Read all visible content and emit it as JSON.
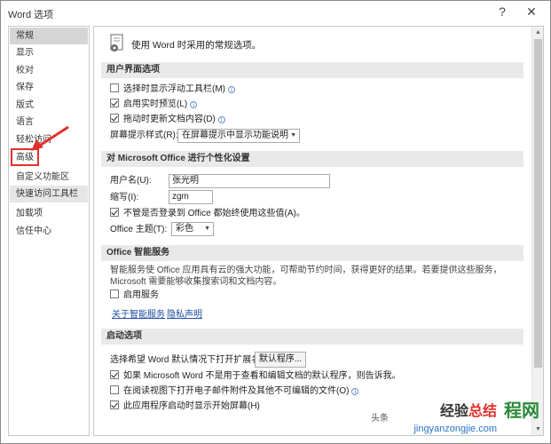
{
  "window": {
    "title": "Word 选项",
    "help": "?",
    "close": "✕"
  },
  "sidebar": {
    "items": [
      {
        "label": "常规"
      },
      {
        "label": "显示"
      },
      {
        "label": "校对"
      },
      {
        "label": "保存"
      },
      {
        "label": "版式"
      },
      {
        "label": "语言"
      },
      {
        "label": "轻松访问"
      },
      {
        "label": "高级"
      },
      {
        "label": "自定义功能区"
      },
      {
        "label": "快速访问工具栏"
      },
      {
        "label": "加载项"
      },
      {
        "label": "信任中心"
      }
    ],
    "selected": "常规"
  },
  "content": {
    "intro": "使用 Word 时采用的常规选项。",
    "ui_section": {
      "title": "用户界面选项",
      "opt1": {
        "label": "选择时显示浮动工具栏(M)",
        "checked": false
      },
      "opt2": {
        "label": "启用实时预览(L)",
        "checked": true
      },
      "opt3": {
        "label": "拖动时更新文档内容(D)",
        "checked": true
      },
      "tooltip_label": "屏幕提示样式(R):",
      "tooltip_value": "在屏幕提示中显示功能说明"
    },
    "personal_section": {
      "title": "对 Microsoft Office 进行个性化设置",
      "username_label": "用户名(U):",
      "username_value": "张光明",
      "initials_label": "缩写(I):",
      "initials_value": "zgm",
      "always_use": {
        "label": "不管是否登录到 Office 都始终使用这些值(A)。",
        "checked": true
      },
      "theme_label": "Office 主题(T):",
      "theme_value": "彩色"
    },
    "intelligent_section": {
      "title": "Office 智能服务",
      "description": "智能服务使 Office 应用具有云的强大功能，可帮助节约时间，获得更好的结果。若要提供这些服务，Microsoft 需要能够收集搜索词和文档内容。",
      "enable": {
        "label": "启用服务",
        "checked": false
      },
      "link_about": "关于智能服务",
      "link_privacy": "隐私声明"
    },
    "startup_section": {
      "title": "启动选项",
      "ext_label": "选择希望 Word 默认情况下打开扩展名:",
      "default_programs_button": "默认程序...",
      "opt1": {
        "label": "如果 Microsoft Word 不是用于查看和编辑文档的默认程序，则告诉我。",
        "checked": true
      },
      "opt2": {
        "label": "在阅读视图下打开电子邮件附件及其他不可编辑的文件(O)",
        "checked": false
      },
      "opt3": {
        "label": "此应用程序启动时显示开始屏幕(H)",
        "checked": true
      }
    }
  },
  "watermark": {
    "source_prefix": "头条",
    "brand_a": "经验",
    "brand_b": "总结",
    "url": "jingyanzongjie.com",
    "partial": "程网"
  },
  "colors": {
    "annotation": "#e0312e",
    "link": "#1f4ea3"
  }
}
